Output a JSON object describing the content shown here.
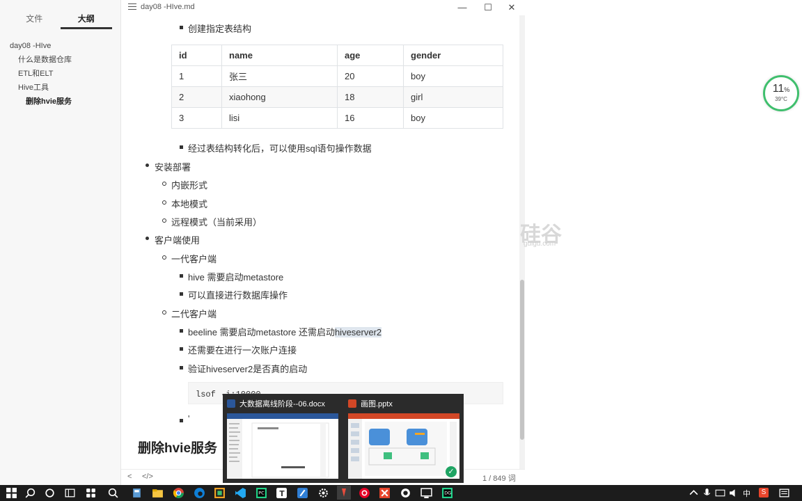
{
  "sidebar": {
    "tabs": [
      "文件",
      "大纲"
    ],
    "outline": [
      "day08 -HIve",
      "什么是数据仓库",
      "ETL和ELT",
      "Hive工具",
      "删除hvie服务"
    ]
  },
  "titlebar": {
    "title": "day08 -HIve.md",
    "minimize": "—",
    "maximize": "☐",
    "close": "✕"
  },
  "content": {
    "item_create_table": "创建指定表结构",
    "table": {
      "headers": [
        "id",
        "name",
        "age",
        "gender"
      ],
      "rows": [
        [
          "1",
          "张三",
          "20",
          "boy"
        ],
        [
          "2",
          "xiaohong",
          "18",
          "girl"
        ],
        [
          "3",
          "lisi",
          "16",
          "boy"
        ]
      ]
    },
    "item_after_convert": "经过表结构转化后，可以使用sql语句操作数据",
    "install_deploy": "安装部署",
    "embedded": "内嵌形式",
    "local_mode": "本地模式",
    "remote_mode": "远程模式（当前采用）",
    "client_usage": "客户端使用",
    "gen1_client": "一代客户端",
    "hive_line": "hive   需要启动metastore",
    "direct_db": "可以直接进行数据库操作",
    "gen2_client": "二代客户端",
    "beeline_line": "beeline    需要启动metastore    还需启动",
    "beeline_hl": "hiveserver2",
    "account_connect": "还需要在进行一次账户连接",
    "verify": "验证hiveserver2是否真的启动",
    "code": "lsof -i:10000",
    "bullet_partial": "'",
    "heading": "删除hvie服务"
  },
  "statusbar": {
    "back": "<",
    "source": "</>",
    "word_count": "1 / 849 词"
  },
  "background": {
    "watermark": "硅谷",
    "watermark_sub": "guigu.com"
  },
  "gauge": {
    "percent": "11",
    "unit": "%",
    "temp": "39°C"
  },
  "preview": {
    "items": [
      {
        "title": "大数据离线阶段--06.docx",
        "color": "#2b579a"
      },
      {
        "title": "画图.pptx",
        "color": "#d24726"
      }
    ]
  },
  "taskbar": {
    "tray_lang": "中",
    "tray_ime": "S"
  }
}
